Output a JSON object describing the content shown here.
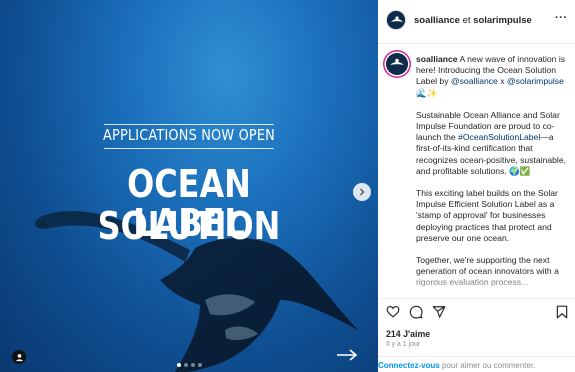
{
  "media": {
    "kicker": "APPLICATIONS NOW OPEN",
    "headline_line1": "OCEAN SOLUTION",
    "headline_line2": "LABEL",
    "carousel_total": 4,
    "carousel_active": 1
  },
  "post": {
    "author": "soalliance",
    "connector": "et",
    "coauthor": "solarimpulse",
    "more": "···"
  },
  "caption": {
    "username": "soalliance",
    "p1_text": "A new wave of innovation is here! Introducing the Ocean Solution Label by",
    "p1_mention1": "@soalliance",
    "p1_x": "x",
    "p1_mention2": "@solarimpulse",
    "p1_emoji": "🌊✨",
    "p2_before": "Sustainable Ocean Alliance and Solar Impulse Foundation are proud to co-launch the",
    "p2_hashtag": "#OceanSolutionLabel",
    "p2_after": "—a first-of-its-kind certification that recognizes ocean-positive, sustainable, and profitable solutions. 🌍✅",
    "p3": "This exciting label builds on the Solar Impulse Efficient Solution Label as a 'stamp of approval' for businesses deploying practices that protect and preserve our one ocean.",
    "p4": "Together, we're supporting the next generation of ocean innovators with a rigorous evaluation process..."
  },
  "engagement": {
    "likes": "214 J'aime",
    "time": "Il y a 1 jour"
  },
  "footer": {
    "login_link": "Connectez-vous",
    "login_text": "pour aimer ou commenter."
  },
  "colors": {
    "ocean_dark": "#0a3870",
    "ocean_light": "#2f8fd4",
    "link": "#00376b",
    "login": "#0095f6"
  }
}
